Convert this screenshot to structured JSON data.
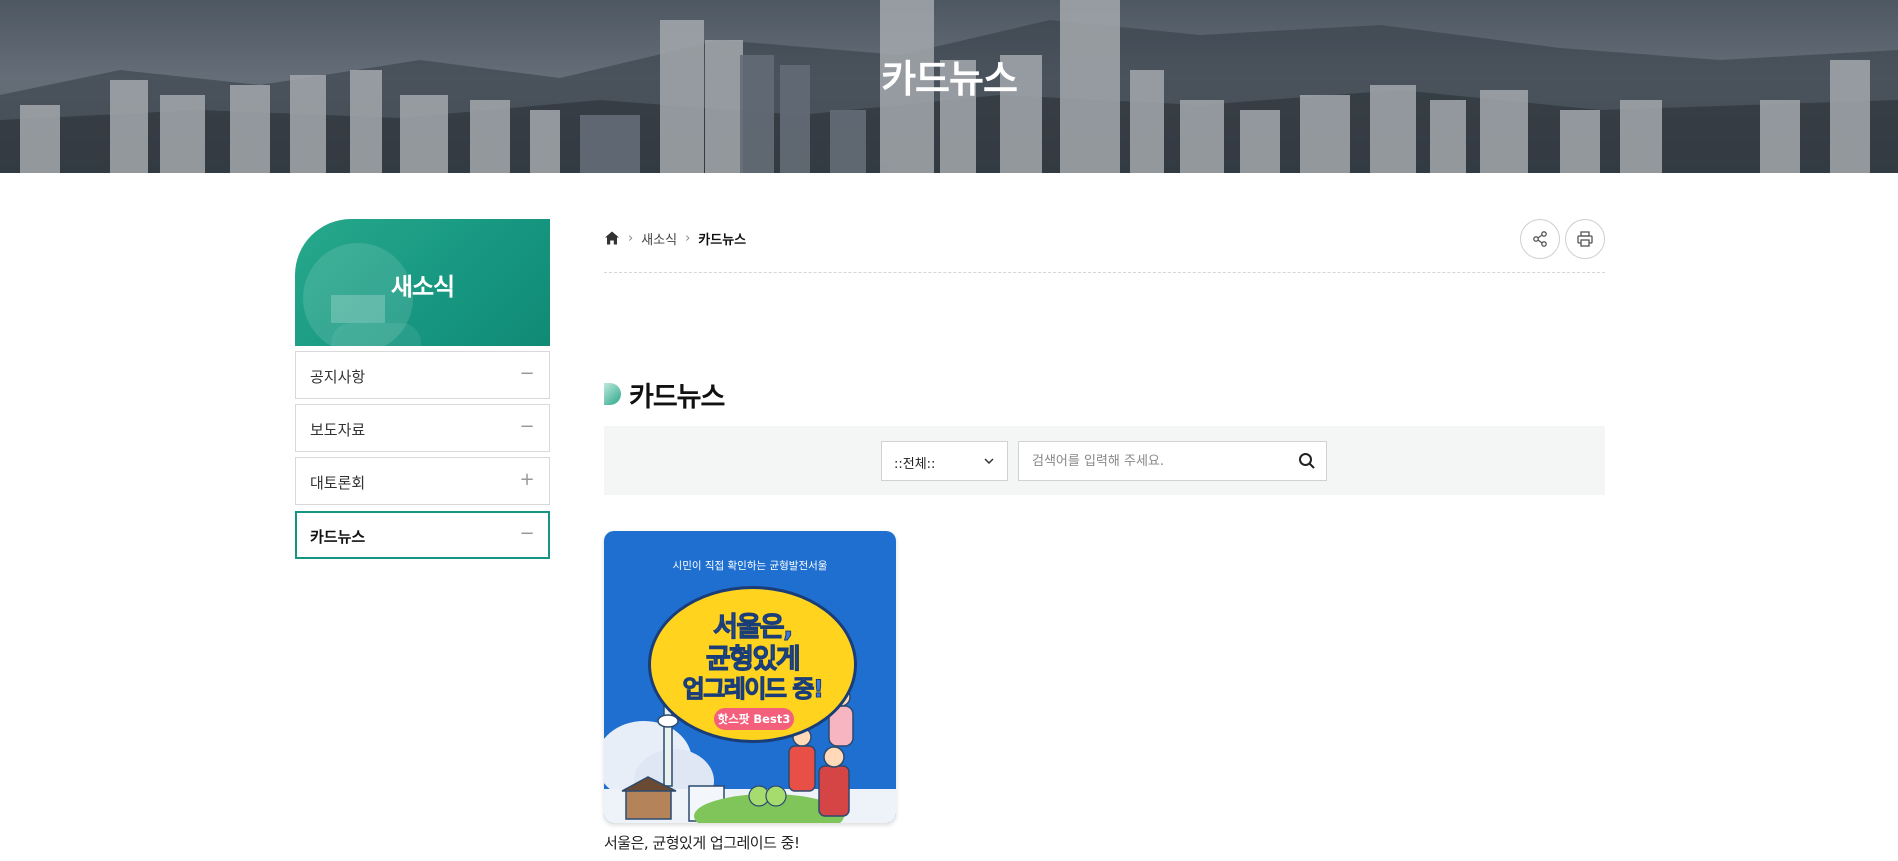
{
  "hero": {
    "title": "카드뉴스"
  },
  "sidebar": {
    "title": "새소식",
    "items": [
      {
        "label": "공지사항",
        "toggle": "−"
      },
      {
        "label": "보도자료",
        "toggle": "−"
      },
      {
        "label": "대토론회",
        "toggle": "+"
      },
      {
        "label": "카드뉴스",
        "toggle": "−",
        "active": true
      }
    ]
  },
  "breadcrumb": {
    "home_icon": "home-icon",
    "items": [
      "새소식",
      "카드뉴스"
    ]
  },
  "tools": {
    "share_icon": "share-icon",
    "print_icon": "print-icon"
  },
  "section": {
    "title": "카드뉴스"
  },
  "search": {
    "select_value": "::전체::",
    "placeholder": "검색어를 입력해 주세요.",
    "button_icon": "search-icon"
  },
  "cards": [
    {
      "title": "서울은, 균형있게 업그레이드 중!",
      "thumb": {
        "top_text": "시민이 직접 확인하는 균형발전서울",
        "line1": "서울은,",
        "line2": "균형있게",
        "line3": "업그레이드 중!",
        "pill": "핫스팟 Best3"
      }
    }
  ],
  "colors": {
    "accent": "#169680",
    "thumb_bg": "#1e6fd0",
    "thumb_oval": "#ffd31e",
    "thumb_pill": "#f4607c"
  }
}
